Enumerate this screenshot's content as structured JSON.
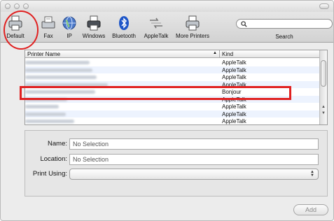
{
  "toolbar": {
    "items": [
      {
        "label": "Default",
        "icon": "printer-icon"
      },
      {
        "label": "Fax",
        "icon": "fax-icon"
      },
      {
        "label": "IP",
        "icon": "globe-icon"
      },
      {
        "label": "Windows",
        "icon": "windows-printer-icon"
      },
      {
        "label": "Bluetooth",
        "icon": "bluetooth-icon"
      },
      {
        "label": "AppleTalk",
        "icon": "appletalk-icon"
      },
      {
        "label": "More Printers",
        "icon": "printer-icon"
      }
    ],
    "search_label": "Search",
    "search_icon": "search-icon"
  },
  "printer_list": {
    "columns": {
      "name": "Printer Name",
      "kind": "Kind"
    },
    "rows": [
      {
        "kind": "AppleTalk"
      },
      {
        "kind": "AppleTalk"
      },
      {
        "kind": "AppleTalk"
      },
      {
        "kind": "AppleTalk"
      },
      {
        "kind": "Bonjour"
      },
      {
        "kind": "AppleTalk"
      },
      {
        "kind": "AppleTalk"
      },
      {
        "kind": "AppleTalk"
      },
      {
        "kind": "AppleTalk"
      }
    ]
  },
  "details": {
    "name_label": "Name:",
    "name_value": "No Selection",
    "location_label": "Location:",
    "location_value": "No Selection",
    "print_using_label": "Print Using:"
  },
  "add_button": "Add",
  "colors": {
    "annotation_red": "#e02020"
  }
}
